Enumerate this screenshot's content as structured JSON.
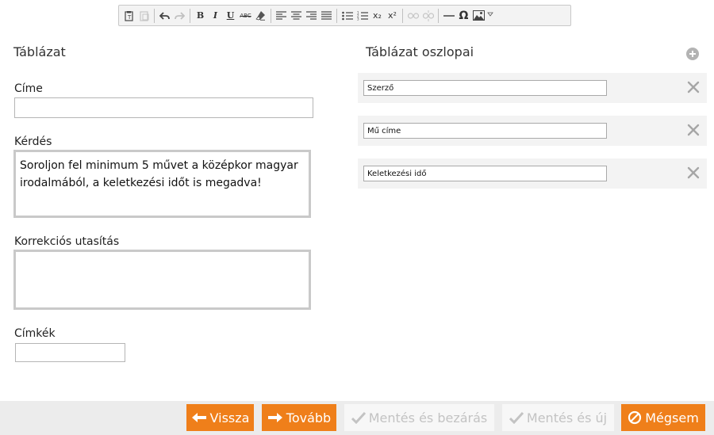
{
  "toolbar": {
    "buttons": [
      {
        "name": "paste-text",
        "icon": "paste-text-icon"
      },
      {
        "name": "paste-word",
        "icon": "paste-word-icon",
        "disabled": true
      },
      {
        "name": "undo",
        "icon": "undo-icon"
      },
      {
        "name": "redo",
        "icon": "redo-icon",
        "disabled": true
      },
      {
        "name": "bold",
        "label": "B"
      },
      {
        "name": "italic",
        "label": "I"
      },
      {
        "name": "underline",
        "label": "U"
      },
      {
        "name": "strike",
        "label": "ABC"
      },
      {
        "name": "remove-format",
        "icon": "eraser-icon"
      },
      {
        "name": "align-left",
        "icon": "align-left-icon"
      },
      {
        "name": "align-center",
        "icon": "align-center-icon"
      },
      {
        "name": "align-right",
        "icon": "align-right-icon"
      },
      {
        "name": "justify",
        "icon": "justify-icon"
      },
      {
        "name": "bulleted-list",
        "icon": "bulleted-list-icon"
      },
      {
        "name": "numbered-list",
        "icon": "numbered-list-icon"
      },
      {
        "name": "subscript",
        "label": "x₂"
      },
      {
        "name": "superscript",
        "label": "x²"
      },
      {
        "name": "link",
        "icon": "link-icon",
        "disabled": true
      },
      {
        "name": "unlink",
        "icon": "unlink-icon",
        "disabled": true
      },
      {
        "name": "horizontal-line",
        "icon": "horizontal-line-icon"
      },
      {
        "name": "special-char",
        "label": "Ω"
      },
      {
        "name": "image",
        "icon": "image-icon"
      }
    ]
  },
  "form": {
    "title": "Táblázat",
    "cime_label": "Címe",
    "cime_value": "",
    "kerdes_label": "Kérdés",
    "kerdes_value": "Soroljon fel minimum 5 művet a középkor magyar irodalmából, a keletkezési időt is megadva!",
    "korrekcio_label": "Korrekciós utasítás",
    "korrekcio_value": "",
    "cimkek_label": "Címkék",
    "cimkek_value": ""
  },
  "columns": {
    "title": "Táblázat oszlopai",
    "items": [
      {
        "value": "Szerző"
      },
      {
        "value": "Mű címe"
      },
      {
        "value": "Keletkezési idő"
      }
    ]
  },
  "footer": {
    "back_label": "Vissza",
    "next_label": "Tovább",
    "save_close_label": "Mentés és bezárás",
    "save_new_label": "Mentés és új",
    "cancel_label": "Mégsem"
  },
  "colors": {
    "accent": "#ef7f1a",
    "footer_bg": "#ececec",
    "row_bg": "#f3f3f3"
  }
}
